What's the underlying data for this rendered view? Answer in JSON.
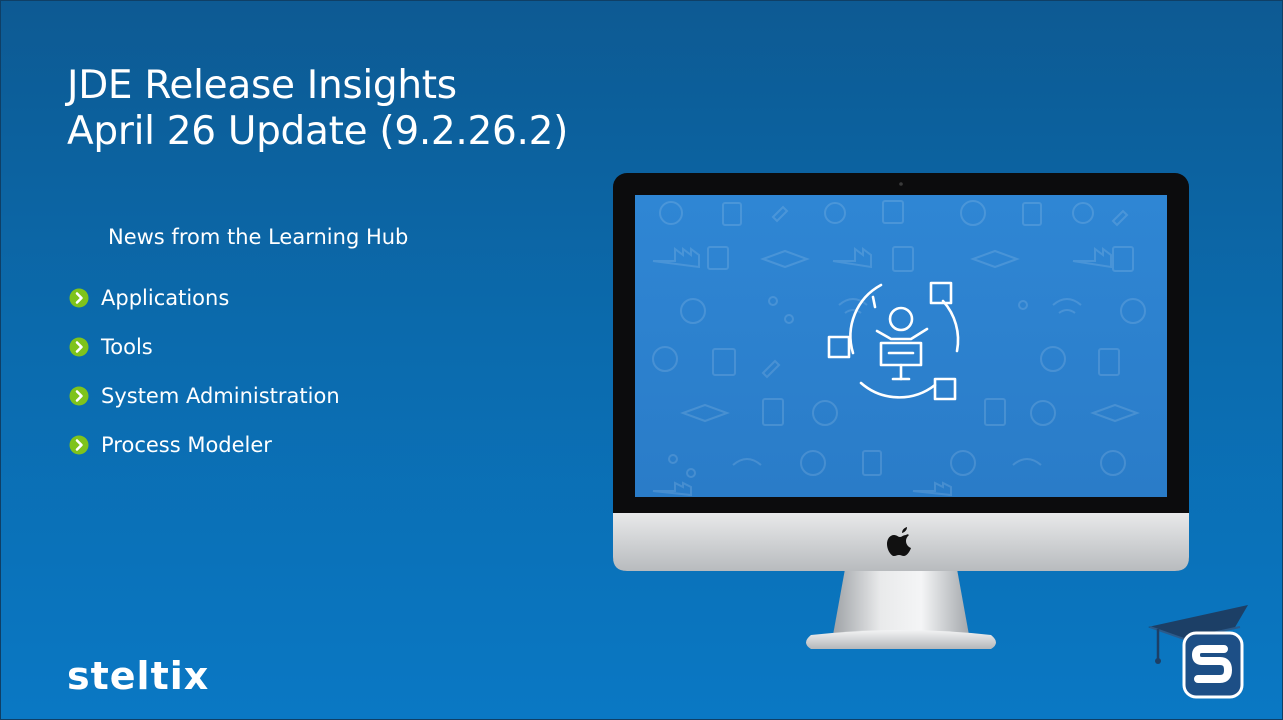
{
  "slide": {
    "title_line1": "JDE Release Insights",
    "title_line2": "April 26 Update (9.2.26.2)",
    "subtitle": "News from the Learning Hub",
    "bullets": [
      {
        "label": "Applications"
      },
      {
        "label": "Tools"
      },
      {
        "label": "System Administration"
      },
      {
        "label": "Process Modeler"
      }
    ],
    "brand": "steltix",
    "colors": {
      "background_top": "#0d5a93",
      "background_bottom": "#0a78c4",
      "bullet_icon": "#7fc31c",
      "screen": "#2f86d4"
    },
    "icons": [
      "chevron-right-icon",
      "apple-logo-icon",
      "presenter-network-icon",
      "graduation-cap-icon",
      "s-logo-icon"
    ]
  }
}
